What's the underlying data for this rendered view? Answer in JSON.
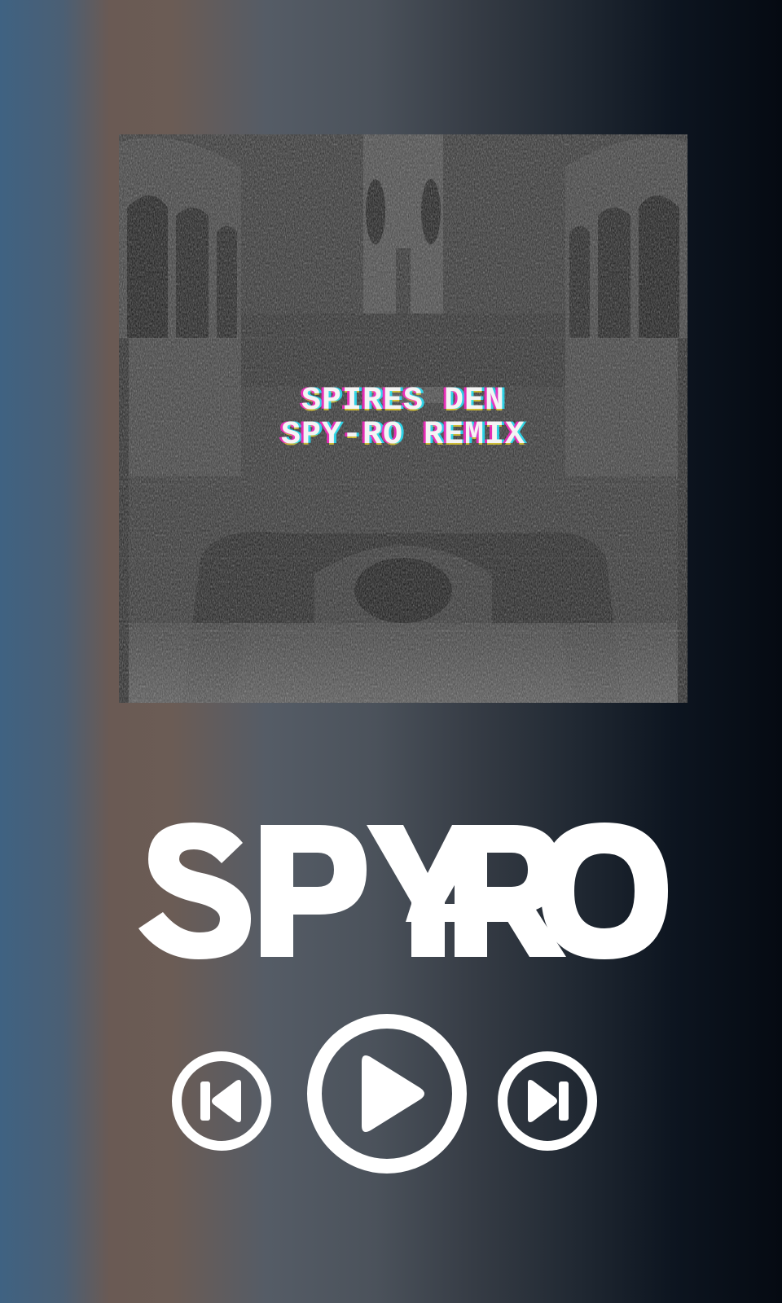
{
  "cover": {
    "title_line1": "SPIRES DEN",
    "title_line2": "SPY-RO REMIX"
  },
  "logo": {
    "text": "SPY-RO"
  },
  "controls": {
    "previous": "skip-previous-icon",
    "play": "play-icon",
    "next": "skip-next-icon"
  },
  "colors": {
    "foreground": "#ffffff",
    "bg_left": "#3f6282",
    "bg_mid": "#6b5c55",
    "bg_right": "#050a12"
  }
}
